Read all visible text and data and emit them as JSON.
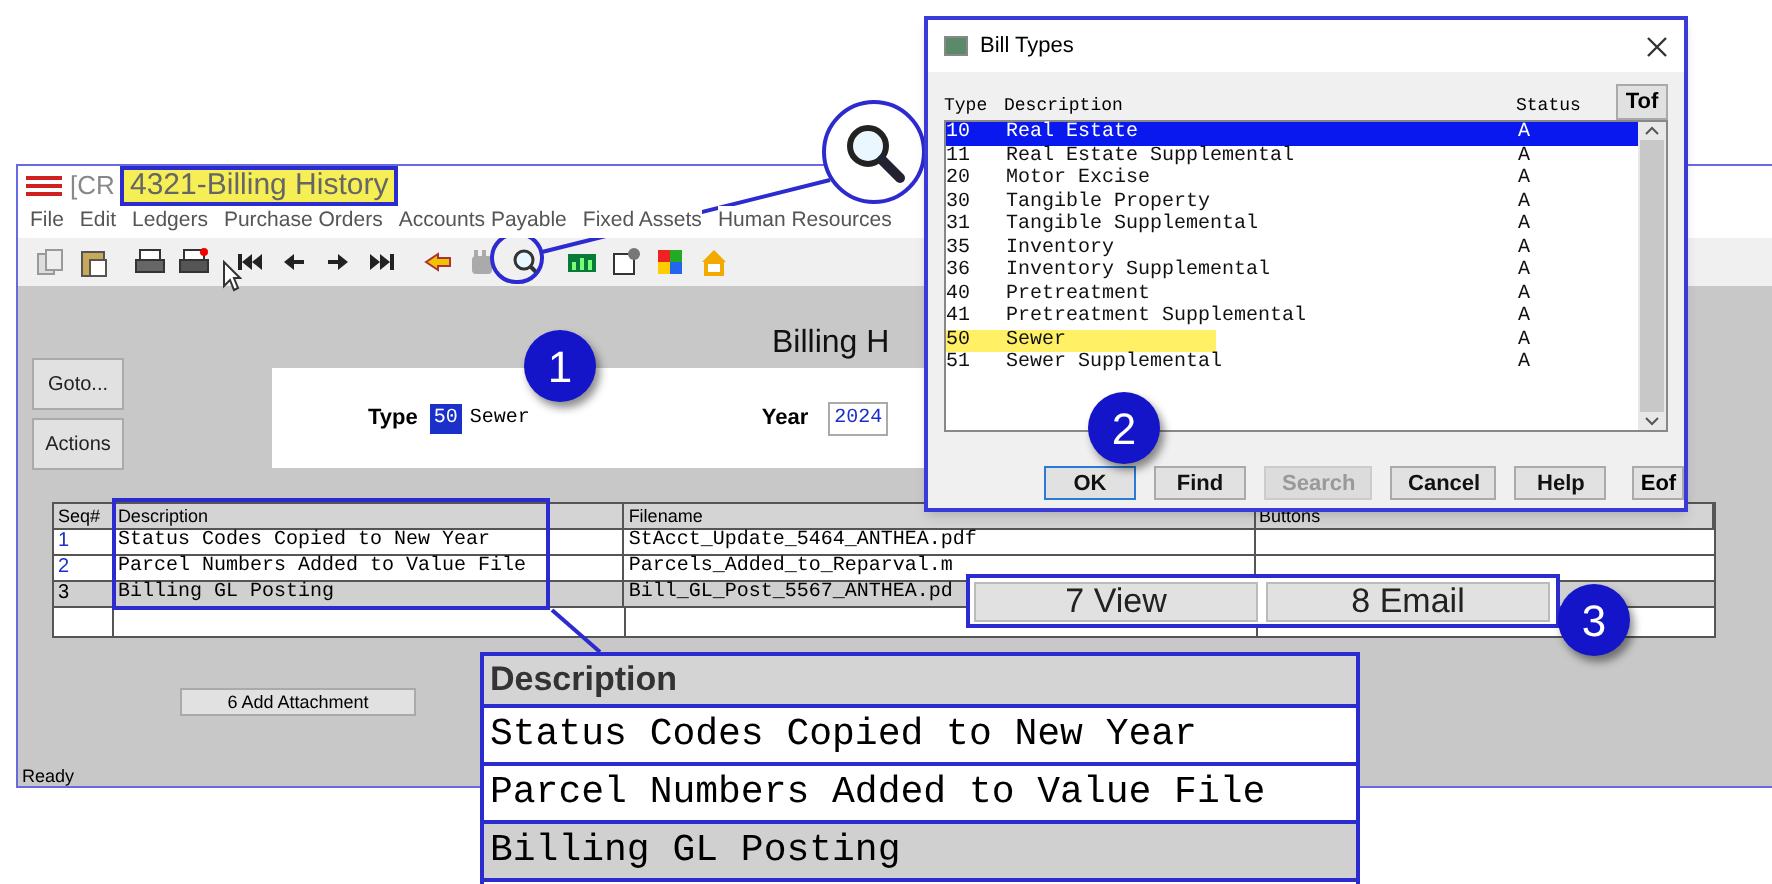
{
  "main_window": {
    "title_prefix": "[CR",
    "title": "4321-Billing History",
    "menu": [
      "File",
      "Edit",
      "Ledgers",
      "Purchase Orders",
      "Accounts Payable",
      "Fixed Assets",
      "Human Resources"
    ],
    "form_title": "Billing H",
    "side_buttons": [
      "Goto...",
      "Actions"
    ],
    "type_label": "Type",
    "type_value": "50",
    "type_name": "Sewer",
    "year_label": "Year",
    "year_value": "2024",
    "table": {
      "columns": [
        "Seq#",
        "Description",
        "Filename",
        "Buttons"
      ],
      "rows": [
        {
          "seq": "1",
          "description": "Status Codes Copied to New Year",
          "filename": "StAcct_Update_5464_ANTHEA.pdf",
          "selected": false
        },
        {
          "seq": "2",
          "description": "Parcel Numbers Added to Value File",
          "filename": "Parcels_Added_to_Reparval.m",
          "selected": false
        },
        {
          "seq": "3",
          "description": "Billing GL Posting",
          "filename": "Bill_GL_Post_5567_ANTHEA.pd",
          "selected": true
        }
      ]
    },
    "add_button": "6 Add Attachment",
    "status_bar": "Ready"
  },
  "dialog": {
    "title": "Bill Types",
    "columns": [
      "Type",
      "Description",
      "Status"
    ],
    "tof": "Tof",
    "eof": "Eof",
    "rows": [
      {
        "type": "10",
        "description": "Real Estate",
        "status": "A",
        "selected": true,
        "highlighted": false
      },
      {
        "type": "11",
        "description": "Real Estate Supplemental",
        "status": "A",
        "selected": false,
        "highlighted": false
      },
      {
        "type": "20",
        "description": "Motor Excise",
        "status": "A",
        "selected": false,
        "highlighted": false
      },
      {
        "type": "30",
        "description": "Tangible Property",
        "status": "A",
        "selected": false,
        "highlighted": false
      },
      {
        "type": "31",
        "description": "Tangible Supplemental",
        "status": "A",
        "selected": false,
        "highlighted": false
      },
      {
        "type": "35",
        "description": "Inventory",
        "status": "A",
        "selected": false,
        "highlighted": false
      },
      {
        "type": "36",
        "description": "Inventory Supplemental",
        "status": "A",
        "selected": false,
        "highlighted": false
      },
      {
        "type": "40",
        "description": "Pretreatment",
        "status": "A",
        "selected": false,
        "highlighted": false
      },
      {
        "type": "41",
        "description": "Pretreatment Supplemental",
        "status": "A",
        "selected": false,
        "highlighted": false
      },
      {
        "type": "50",
        "description": "Sewer",
        "status": "A",
        "selected": false,
        "highlighted": true
      },
      {
        "type": "51",
        "description": "Sewer Supplemental",
        "status": "A",
        "selected": false,
        "highlighted": false
      }
    ],
    "buttons": [
      {
        "label": "OK",
        "disabled": false,
        "default": true
      },
      {
        "label": "Find",
        "disabled": false,
        "default": false
      },
      {
        "label": "Search",
        "disabled": true,
        "default": false
      },
      {
        "label": "Cancel",
        "disabled": false,
        "default": false
      },
      {
        "label": "Help",
        "disabled": false,
        "default": false
      }
    ]
  },
  "callouts": [
    {
      "number": "1"
    },
    {
      "number": "2"
    },
    {
      "number": "3"
    }
  ],
  "inset_buttons": [
    "7 View",
    "8 Email"
  ],
  "zoom_inset": {
    "header": "Description",
    "rows": [
      {
        "text": "Status Codes Copied to New Year",
        "selected": false
      },
      {
        "text": "Parcel Numbers Added to Value File",
        "selected": false
      },
      {
        "text": "Billing GL Posting",
        "selected": true
      }
    ]
  }
}
